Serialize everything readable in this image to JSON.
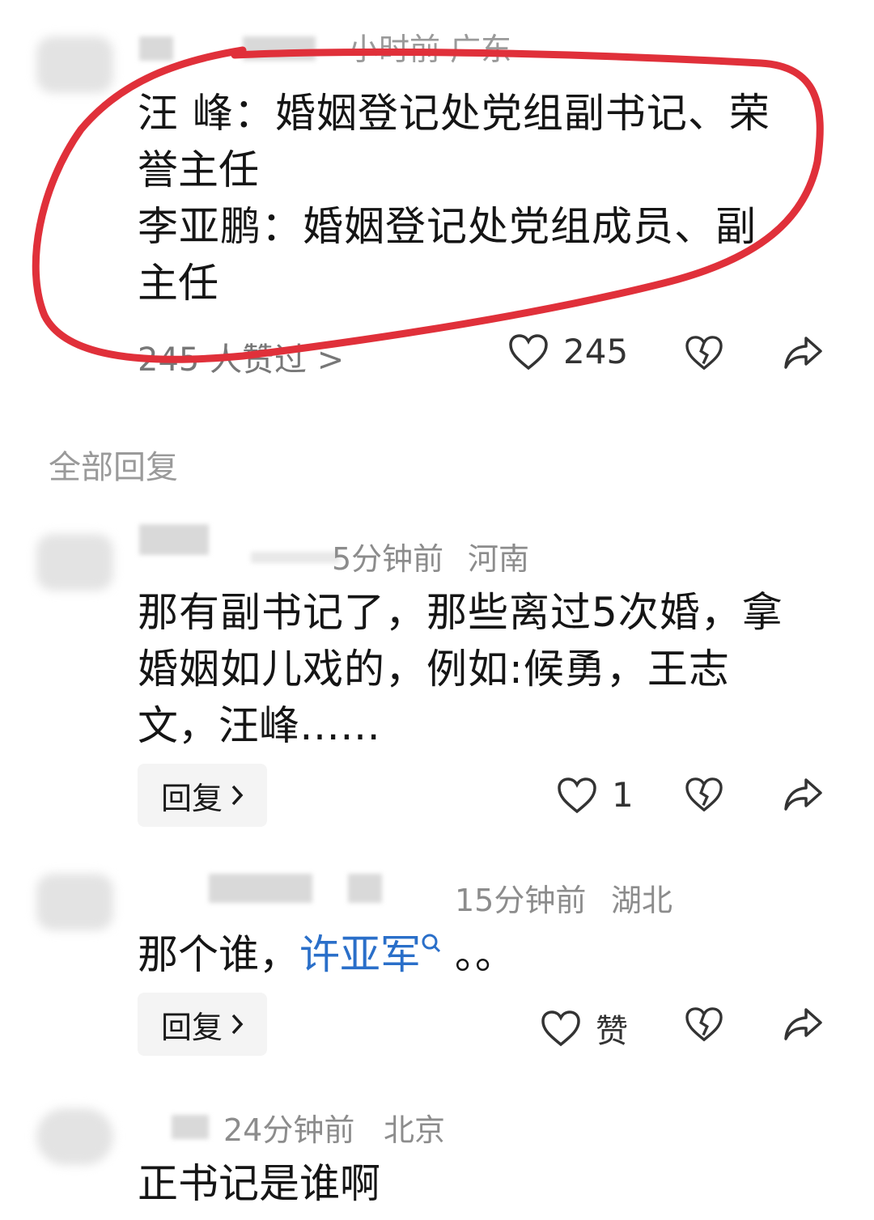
{
  "comment_top": {
    "meta": "小时前  广东",
    "lines": [
      "汪 峰：婚姻登记处党组副书记、荣",
      "誉主任",
      "李亚鹏：婚姻登记处党组成员、副",
      "主任"
    ],
    "likes_summary": "245 人赞过 >",
    "like_count": "245"
  },
  "section_title": "全部回复",
  "replies": [
    {
      "meta_time": "5分钟前",
      "meta_region": "河南",
      "lines": [
        "那有副书记了，那些离过5次婚，拿",
        "婚姻如儿戏的，例如:候勇，王志",
        "文，汪峰……"
      ],
      "reply_label": "回复",
      "like_count": "1"
    },
    {
      "meta_time": "15分钟前",
      "meta_region": "湖北",
      "text_prefix": "那个谁，",
      "text_link": "许亚军",
      "text_suffix": " 。。",
      "reply_label": "回复",
      "like_label": "赞"
    },
    {
      "meta_time": "24分钟前",
      "meta_region": "北京",
      "text": "正书记是谁啊"
    }
  ],
  "icons": {
    "like": "heart-outline-icon",
    "dislike": "broken-heart-icon",
    "share": "share-arrow-icon",
    "chevron": "chevron-right-icon",
    "search": "search-icon"
  },
  "colors": {
    "annotation": "#e0303a",
    "link": "#2a6fc9",
    "meta": "#8c8c8c"
  }
}
